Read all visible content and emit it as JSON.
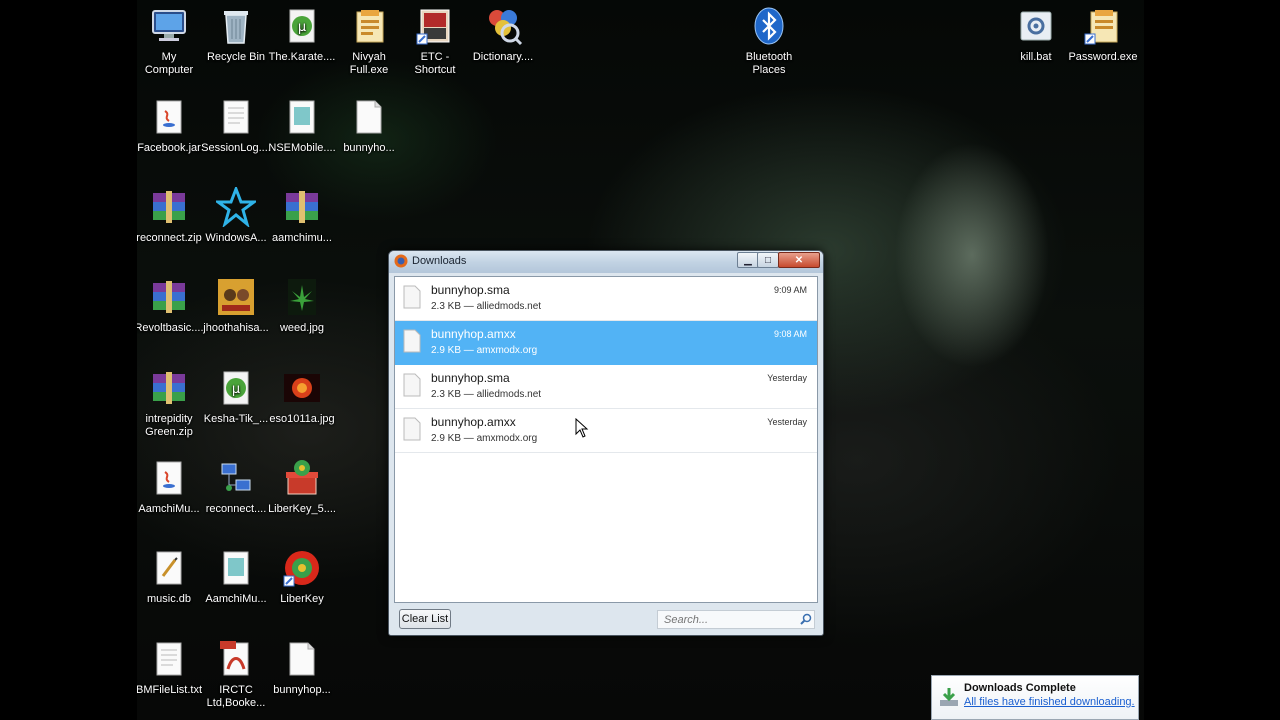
{
  "desktop_icons": [
    {
      "name": "my-computer",
      "label": "My\nComputer",
      "icon": "monitor-icon"
    },
    {
      "name": "recycle-bin",
      "label": "Recycle Bin",
      "icon": "trash-icon"
    },
    {
      "name": "the-karate",
      "label": "The.Karate....",
      "icon": "torrent-icon"
    },
    {
      "name": "nivyah-full",
      "label": "Nivyah\nFull.exe",
      "icon": "exe-icon"
    },
    {
      "name": "etc-shortcut",
      "label": "ETC -\nShortcut",
      "icon": "folder-icon"
    },
    {
      "name": "dictionary",
      "label": "Dictionary....",
      "icon": "dictionary-icon"
    },
    {
      "name": "bluetooth-places",
      "label": "Bluetooth\nPlaces",
      "icon": "bluetooth-icon"
    },
    {
      "name": "kill-bat",
      "label": "kill.bat",
      "icon": "batch-icon"
    },
    {
      "name": "password-exe",
      "label": "Password.exe",
      "icon": "exe-icon"
    },
    {
      "name": "facebook-jar",
      "label": "Facebook.jar",
      "icon": "java-icon"
    },
    {
      "name": "session-log",
      "label": "SessionLog....",
      "icon": "text-file-icon"
    },
    {
      "name": "nse-mobile",
      "label": "NSEMobile....",
      "icon": "file-icon"
    },
    {
      "name": "bunnyhop-1",
      "label": "bunnyho...",
      "icon": "blank-file-icon"
    },
    {
      "name": "reconnect-zip",
      "label": "reconnect.zip",
      "icon": "archive-icon"
    },
    {
      "name": "windowsa",
      "label": "WindowsA...",
      "icon": "star-icon"
    },
    {
      "name": "aamchimu-1",
      "label": "aamchimu...",
      "icon": "archive-icon"
    },
    {
      "name": "revoltbasic",
      "label": "Revoltbasic....",
      "icon": "archive-icon"
    },
    {
      "name": "jhoothahisa",
      "label": "jhoothahisa...",
      "icon": "image-icon"
    },
    {
      "name": "weed-jpg",
      "label": "weed.jpg",
      "icon": "image-icon"
    },
    {
      "name": "intrepidity-green",
      "label": "intrepidity\nGreen.zip",
      "icon": "archive-icon"
    },
    {
      "name": "kesha-tik",
      "label": "Kesha-Tik_...",
      "icon": "torrent-icon"
    },
    {
      "name": "eso1011a",
      "label": "eso1011a.jpg",
      "icon": "image-icon"
    },
    {
      "name": "aamchimu-2",
      "label": "AamchiMu...",
      "icon": "java-icon"
    },
    {
      "name": "reconnect-2",
      "label": "reconnect....",
      "icon": "network-icon"
    },
    {
      "name": "liberkey-5",
      "label": "LiberKey_5....",
      "icon": "liberkey-setup-icon"
    },
    {
      "name": "music-db",
      "label": "music.db",
      "icon": "db-file-icon"
    },
    {
      "name": "aamchimu-3",
      "label": "AamchiMu...",
      "icon": "file-icon"
    },
    {
      "name": "liberkey",
      "label": "LiberKey",
      "icon": "liberkey-icon"
    },
    {
      "name": "bmfilelist",
      "label": "BMFileList.txt",
      "icon": "text-file-icon"
    },
    {
      "name": "irctc",
      "label": "IRCTC\nLtd,Booke...",
      "icon": "pdf-icon"
    },
    {
      "name": "bunnyhop-2",
      "label": "bunnyhop...",
      "icon": "blank-file-icon"
    }
  ],
  "downloads_window": {
    "title": "Downloads",
    "items": [
      {
        "name": "bunnyhop.sma",
        "meta": "2.3 KB — alliedmods.net",
        "time": "9:09 AM",
        "selected": false
      },
      {
        "name": "bunnyhop.amxx",
        "meta": "2.9 KB — amxmodx.org",
        "time": "9:08 AM",
        "selected": true
      },
      {
        "name": "bunnyhop.sma",
        "meta": "2.3 KB — alliedmods.net",
        "time": "Yesterday",
        "selected": false
      },
      {
        "name": "bunnyhop.amxx",
        "meta": "2.9 KB — amxmodx.org",
        "time": "Yesterday",
        "selected": false
      }
    ],
    "clear_label": "Clear List",
    "search_placeholder": "Search..."
  },
  "notification": {
    "title": "Downloads Complete",
    "message": "All files have finished downloading."
  },
  "colors": {
    "selection": "#52b3f5",
    "link": "#1a5fd0"
  }
}
